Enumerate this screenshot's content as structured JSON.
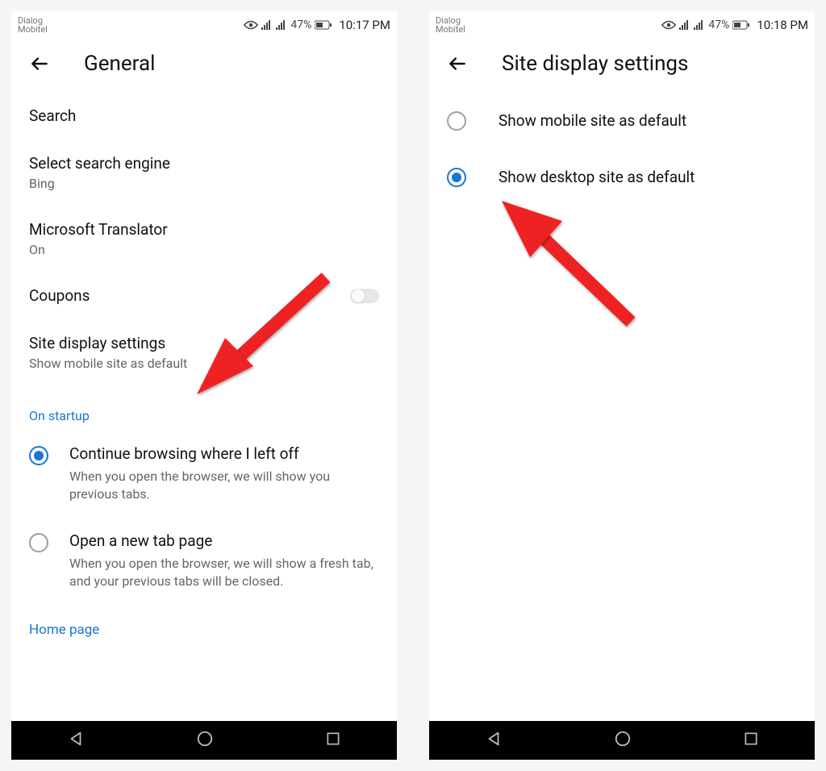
{
  "left": {
    "status": {
      "carrier1": "Dialog",
      "carrier2": "Mobitel",
      "battery": "47%",
      "time": "10:17 PM"
    },
    "header": {
      "title": "General"
    },
    "search_label": "Search",
    "search_engine": {
      "title": "Select search engine",
      "value": "Bing"
    },
    "translator": {
      "title": "Microsoft Translator",
      "value": "On"
    },
    "coupons_label": "Coupons",
    "site_display": {
      "title": "Site display settings",
      "value": "Show mobile site as default"
    },
    "startup_section": "On startup",
    "startup_opt1": {
      "title": "Continue browsing where I left off",
      "sub": "When you open the browser, we will show you previous tabs."
    },
    "startup_opt2": {
      "title": "Open a new tab page",
      "sub": "When you open the browser, we will show a fresh tab, and your previous tabs will be closed."
    },
    "homepage_link": "Home page"
  },
  "right": {
    "status": {
      "carrier1": "Dialog",
      "carrier2": "Mobitel",
      "battery": "47%",
      "time": "10:18 PM"
    },
    "header": {
      "title": "Site display settings"
    },
    "option1": "Show mobile site as default",
    "option2": "Show desktop site as default"
  }
}
